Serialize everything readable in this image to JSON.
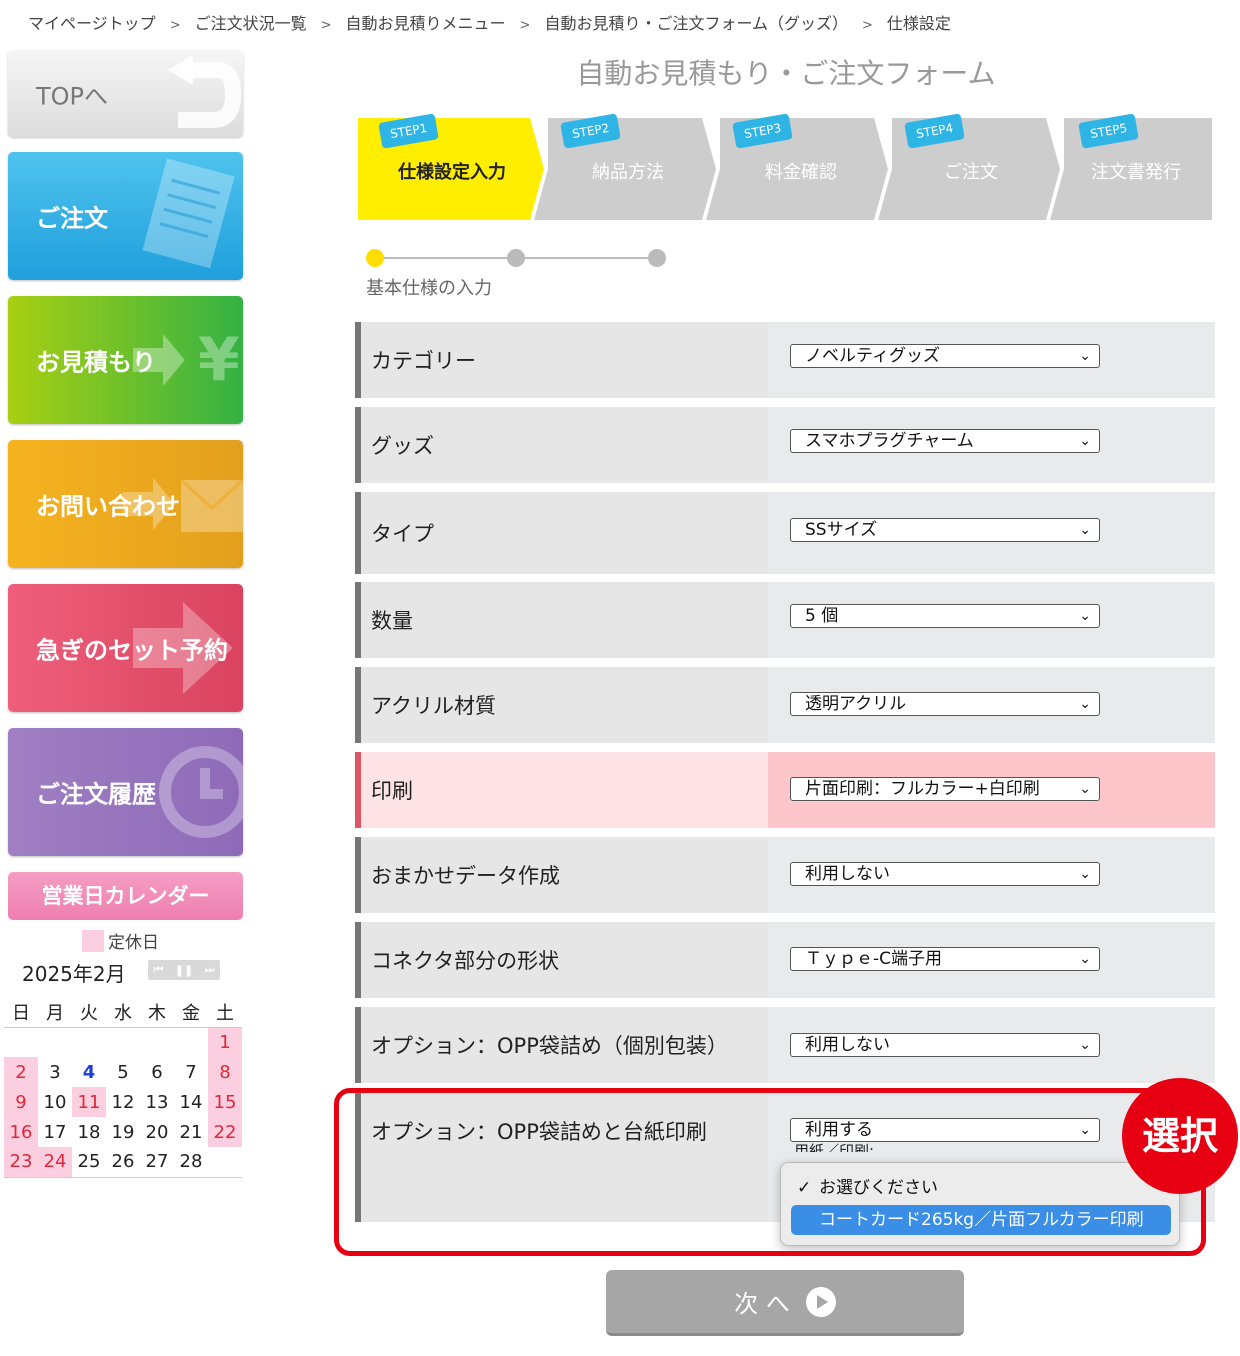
{
  "breadcrumb": {
    "items": [
      "マイページトップ",
      "ご注文状況一覧",
      "自動お見積りメニュー",
      "自動お見積り・ご注文フォーム（グッズ）",
      "仕様設定"
    ],
    "separator": ">"
  },
  "sidebar": {
    "top": "TOPへ",
    "order": "ご注文",
    "quote": "お見積もり",
    "contact": "お問い合わせ",
    "rush": "急ぎのセット予約",
    "history": "ご注文履歴"
  },
  "calendar": {
    "title": "営業日カレンダー",
    "legend": "定休日",
    "month": "2025年2月",
    "weekdays": [
      "日",
      "月",
      "火",
      "水",
      "木",
      "金",
      "土"
    ],
    "weeks": [
      [
        "",
        "",
        "",
        "",
        "",
        "",
        "1"
      ],
      [
        "2",
        "3",
        "4",
        "5",
        "6",
        "7",
        "8"
      ],
      [
        "9",
        "10",
        "11",
        "12",
        "13",
        "14",
        "15"
      ],
      [
        "16",
        "17",
        "18",
        "19",
        "20",
        "21",
        "22"
      ],
      [
        "23",
        "24",
        "25",
        "26",
        "27",
        "28",
        ""
      ]
    ],
    "holiday_color": "#fccfe0"
  },
  "form": {
    "title": "自動お見積もり・ご注文フォーム",
    "steps": [
      {
        "badge": "STEP1",
        "label": "仕様設定入力",
        "active": true
      },
      {
        "badge": "STEP2",
        "label": "納品方法",
        "active": false
      },
      {
        "badge": "STEP3",
        "label": "料金確認",
        "active": false
      },
      {
        "badge": "STEP4",
        "label": "ご注文",
        "active": false
      },
      {
        "badge": "STEP5",
        "label": "注文書発行",
        "active": false
      }
    ],
    "progress_label": "基本仕様の入力",
    "rows": [
      {
        "label": "カテゴリー",
        "value": "ノベルティグッズ"
      },
      {
        "label": "グッズ",
        "value": "スマホプラグチャーム"
      },
      {
        "label": "タイプ",
        "value": "SSサイズ"
      },
      {
        "label": "数量",
        "value": "5 個"
      },
      {
        "label": "アクリル材質",
        "value": "透明アクリル"
      },
      {
        "label": "印刷",
        "value": "片面印刷：フルカラー+白印刷"
      },
      {
        "label": "おまかせデータ作成",
        "value": "利用しない"
      },
      {
        "label": "コネクタ部分の形状",
        "value": "Ｔｙｐｅ-C端子用"
      },
      {
        "label": "オプション：OPP袋詰め（個別包装）",
        "value": "利用しない"
      },
      {
        "label": "オプション：OPP袋詰めと台紙印刷",
        "value": "利用する"
      }
    ],
    "paper_label": "用紙／印刷:",
    "dropdown_options": [
      "お選びください",
      "コートカード265kg／片面フルカラー印刷"
    ],
    "checkmark": "✓",
    "callout": "選択",
    "next_button": "次 へ"
  },
  "colors": {
    "active_step": "#ffee00",
    "highlight_row": "#fcc6cb",
    "callout_red": "#e60012",
    "selected_option": "#3b8ee6"
  }
}
